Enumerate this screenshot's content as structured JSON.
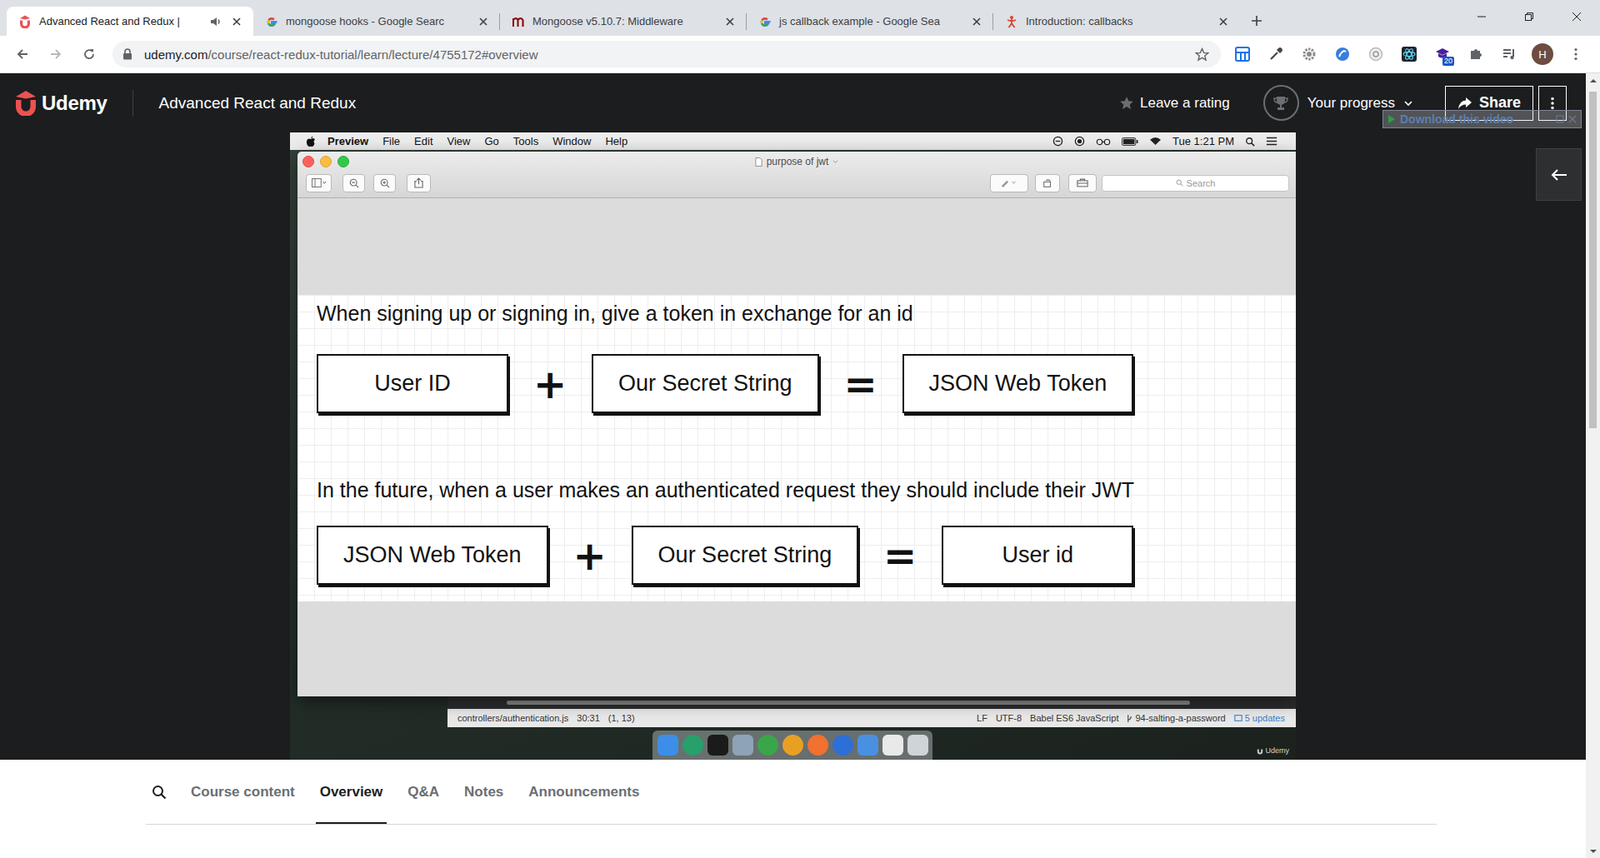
{
  "browser": {
    "tabs": [
      {
        "label": "Advanced React and Redux |",
        "selected": true,
        "audio": true,
        "kind": "udemy"
      },
      {
        "label": "mongoose hooks - Google Searc",
        "selected": false,
        "audio": false,
        "kind": "google"
      },
      {
        "label": "Mongoose v5.10.7: Middleware",
        "selected": false,
        "audio": false,
        "kind": "mongoose"
      },
      {
        "label": "js callback example - Google Sea",
        "selected": false,
        "audio": false,
        "kind": "google"
      },
      {
        "label": "Introduction: callbacks",
        "selected": false,
        "audio": false,
        "kind": "javascript"
      }
    ],
    "address": {
      "host": "udemy.com",
      "path": "/course/react-redux-tutorial/learn/lecture/4755172#overview",
      "bookmarked": false
    },
    "extension_badge": "20",
    "profile_initial": "H"
  },
  "header": {
    "logo": "Udemy",
    "course_title": "Advanced React and Redux",
    "rating": "Leave a rating",
    "progress": "Your progress",
    "share": "Share",
    "download_overlay": "Download this video"
  },
  "video": {
    "menubar": {
      "app": "Preview",
      "menus": [
        "File",
        "Edit",
        "View",
        "Go",
        "Tools",
        "Window",
        "Help"
      ],
      "clock": "Tue 1:21 PM"
    },
    "preview": {
      "title": "purpose of jwt",
      "search_placeholder": "Search"
    },
    "diagram": {
      "plus": "+",
      "equals": "=",
      "rows": [
        {
          "caption": "When signing up or signing in, give a token in exchange for an id",
          "terms": [
            "User ID",
            "Our Secret String",
            "JSON Web Token"
          ]
        },
        {
          "caption": "In the future, when a user makes an authenticated request they should include their JWT",
          "terms": [
            "JSON Web Token",
            "Our Secret String",
            "User id"
          ]
        }
      ]
    },
    "editor_status": {
      "file": "controllers/authentication.js",
      "cursor": "30:31",
      "selection": "(1, 13)",
      "line_ending": "LF",
      "encoding": "UTF-8",
      "grammar": "Babel ES6 JavaScript",
      "branch": "94-salting-a-password",
      "updates": "5 updates"
    },
    "watermark": "Udemy"
  },
  "course_tabs": [
    {
      "label": "Course content",
      "selected": false
    },
    {
      "label": "Overview",
      "selected": true
    },
    {
      "label": "Q&A",
      "selected": false
    },
    {
      "label": "Notes",
      "selected": false
    },
    {
      "label": "Announcements",
      "selected": false
    }
  ]
}
